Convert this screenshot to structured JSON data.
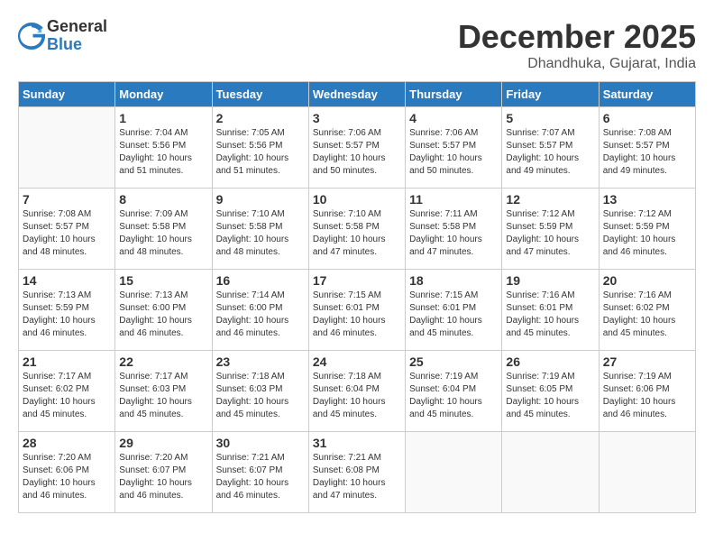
{
  "logo": {
    "general": "General",
    "blue": "Blue"
  },
  "title": "December 2025",
  "subtitle": "Dhandhuka, Gujarat, India",
  "days_header": [
    "Sunday",
    "Monday",
    "Tuesday",
    "Wednesday",
    "Thursday",
    "Friday",
    "Saturday"
  ],
  "weeks": [
    [
      {
        "day": "",
        "info": ""
      },
      {
        "day": "1",
        "info": "Sunrise: 7:04 AM\nSunset: 5:56 PM\nDaylight: 10 hours\nand 51 minutes."
      },
      {
        "day": "2",
        "info": "Sunrise: 7:05 AM\nSunset: 5:56 PM\nDaylight: 10 hours\nand 51 minutes."
      },
      {
        "day": "3",
        "info": "Sunrise: 7:06 AM\nSunset: 5:57 PM\nDaylight: 10 hours\nand 50 minutes."
      },
      {
        "day": "4",
        "info": "Sunrise: 7:06 AM\nSunset: 5:57 PM\nDaylight: 10 hours\nand 50 minutes."
      },
      {
        "day": "5",
        "info": "Sunrise: 7:07 AM\nSunset: 5:57 PM\nDaylight: 10 hours\nand 49 minutes."
      },
      {
        "day": "6",
        "info": "Sunrise: 7:08 AM\nSunset: 5:57 PM\nDaylight: 10 hours\nand 49 minutes."
      }
    ],
    [
      {
        "day": "7",
        "info": "Sunrise: 7:08 AM\nSunset: 5:57 PM\nDaylight: 10 hours\nand 48 minutes."
      },
      {
        "day": "8",
        "info": "Sunrise: 7:09 AM\nSunset: 5:58 PM\nDaylight: 10 hours\nand 48 minutes."
      },
      {
        "day": "9",
        "info": "Sunrise: 7:10 AM\nSunset: 5:58 PM\nDaylight: 10 hours\nand 48 minutes."
      },
      {
        "day": "10",
        "info": "Sunrise: 7:10 AM\nSunset: 5:58 PM\nDaylight: 10 hours\nand 47 minutes."
      },
      {
        "day": "11",
        "info": "Sunrise: 7:11 AM\nSunset: 5:58 PM\nDaylight: 10 hours\nand 47 minutes."
      },
      {
        "day": "12",
        "info": "Sunrise: 7:12 AM\nSunset: 5:59 PM\nDaylight: 10 hours\nand 47 minutes."
      },
      {
        "day": "13",
        "info": "Sunrise: 7:12 AM\nSunset: 5:59 PM\nDaylight: 10 hours\nand 46 minutes."
      }
    ],
    [
      {
        "day": "14",
        "info": "Sunrise: 7:13 AM\nSunset: 5:59 PM\nDaylight: 10 hours\nand 46 minutes."
      },
      {
        "day": "15",
        "info": "Sunrise: 7:13 AM\nSunset: 6:00 PM\nDaylight: 10 hours\nand 46 minutes."
      },
      {
        "day": "16",
        "info": "Sunrise: 7:14 AM\nSunset: 6:00 PM\nDaylight: 10 hours\nand 46 minutes."
      },
      {
        "day": "17",
        "info": "Sunrise: 7:15 AM\nSunset: 6:01 PM\nDaylight: 10 hours\nand 46 minutes."
      },
      {
        "day": "18",
        "info": "Sunrise: 7:15 AM\nSunset: 6:01 PM\nDaylight: 10 hours\nand 45 minutes."
      },
      {
        "day": "19",
        "info": "Sunrise: 7:16 AM\nSunset: 6:01 PM\nDaylight: 10 hours\nand 45 minutes."
      },
      {
        "day": "20",
        "info": "Sunrise: 7:16 AM\nSunset: 6:02 PM\nDaylight: 10 hours\nand 45 minutes."
      }
    ],
    [
      {
        "day": "21",
        "info": "Sunrise: 7:17 AM\nSunset: 6:02 PM\nDaylight: 10 hours\nand 45 minutes."
      },
      {
        "day": "22",
        "info": "Sunrise: 7:17 AM\nSunset: 6:03 PM\nDaylight: 10 hours\nand 45 minutes."
      },
      {
        "day": "23",
        "info": "Sunrise: 7:18 AM\nSunset: 6:03 PM\nDaylight: 10 hours\nand 45 minutes."
      },
      {
        "day": "24",
        "info": "Sunrise: 7:18 AM\nSunset: 6:04 PM\nDaylight: 10 hours\nand 45 minutes."
      },
      {
        "day": "25",
        "info": "Sunrise: 7:19 AM\nSunset: 6:04 PM\nDaylight: 10 hours\nand 45 minutes."
      },
      {
        "day": "26",
        "info": "Sunrise: 7:19 AM\nSunset: 6:05 PM\nDaylight: 10 hours\nand 45 minutes."
      },
      {
        "day": "27",
        "info": "Sunrise: 7:19 AM\nSunset: 6:06 PM\nDaylight: 10 hours\nand 46 minutes."
      }
    ],
    [
      {
        "day": "28",
        "info": "Sunrise: 7:20 AM\nSunset: 6:06 PM\nDaylight: 10 hours\nand 46 minutes."
      },
      {
        "day": "29",
        "info": "Sunrise: 7:20 AM\nSunset: 6:07 PM\nDaylight: 10 hours\nand 46 minutes."
      },
      {
        "day": "30",
        "info": "Sunrise: 7:21 AM\nSunset: 6:07 PM\nDaylight: 10 hours\nand 46 minutes."
      },
      {
        "day": "31",
        "info": "Sunrise: 7:21 AM\nSunset: 6:08 PM\nDaylight: 10 hours\nand 47 minutes."
      },
      {
        "day": "",
        "info": ""
      },
      {
        "day": "",
        "info": ""
      },
      {
        "day": "",
        "info": ""
      }
    ]
  ]
}
